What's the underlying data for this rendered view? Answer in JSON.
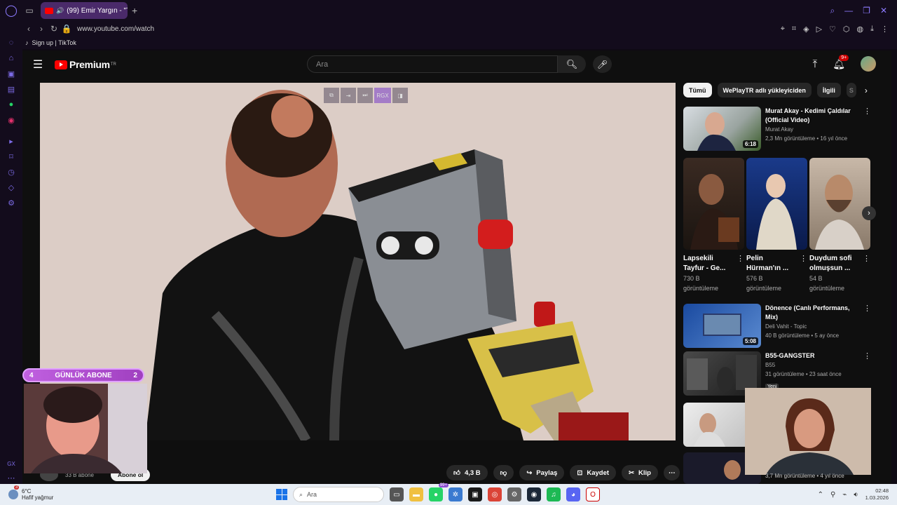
{
  "browser": {
    "tab_title": "(99) Emir Yargın - \"Tok",
    "url": "www.youtube.com/watch",
    "bookmark": "Sign up | TikTok"
  },
  "youtube": {
    "logo_text": "Premium",
    "logo_region": "TR",
    "search_placeholder": "Ara",
    "notif_count": "9+",
    "actions": {
      "like_count": "4,3 B",
      "share": "Paylaş",
      "save": "Kaydet",
      "clip": "Klip"
    },
    "channel": {
      "subs": "33 B abone",
      "subscribe": "Abone ol"
    },
    "video_overlay": {
      "rgx": "RGX"
    },
    "chips": [
      "Tümü",
      "WePlayTR adlı yükleyiciden",
      "İlgili",
      "S"
    ],
    "recs": [
      {
        "title": "Murat Akay - Kedimi Çaldılar (Official Video)",
        "channel": "Murat Akay",
        "meta": "2,3 Mn görüntüleme • 16 yıl önce",
        "duration": "6:18"
      },
      {
        "title": "Dönence (Canlı Performans, Mix)",
        "channel": "Deli Vahit - Topic",
        "meta": "40 B görüntüleme • 5 ay önce",
        "duration": "5:08"
      },
      {
        "title": "B55-GANGSTER",
        "channel": "B55",
        "meta": "31 görüntüleme • 23 saat önce",
        "badge": "Yeni"
      }
    ],
    "shorts": [
      {
        "title": "Lapsekili Tayfur - Ge...",
        "views": "730 B",
        "views_label": "görüntüleme"
      },
      {
        "title": "Pelin Hürman'ın ...",
        "views": "576 B",
        "views_label": "görüntüleme"
      },
      {
        "title": "Duydum sofi olmuşsun ...",
        "views": "54 B",
        "views_label": "görüntüleme"
      }
    ],
    "last_meta": "3,7 Mn görüntüleme • 4 yıl önce"
  },
  "overlay": {
    "abone_left": "4",
    "abone_label": "GÜNLÜK ABONE",
    "abone_right": "2"
  },
  "taskbar": {
    "temp": "6°C",
    "weather": "Hafif yağmur",
    "weather_badge": "3",
    "search": "Ara",
    "whatsapp_badge": "99+",
    "time": "02:48",
    "date": "1.03.2026"
  }
}
